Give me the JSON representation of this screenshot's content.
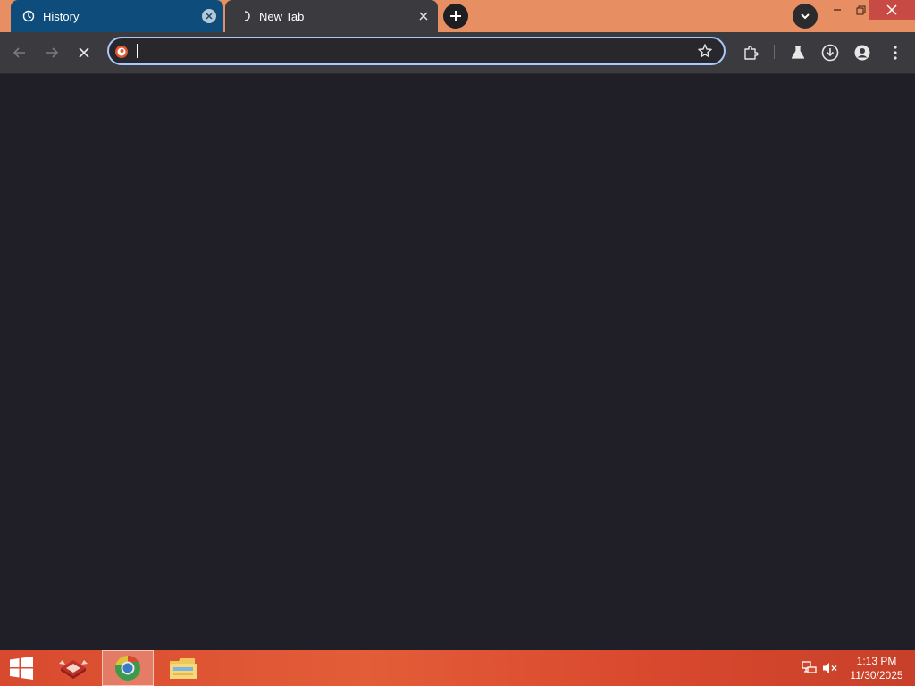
{
  "tabs": [
    {
      "title": "History",
      "icon": "history-icon",
      "active": true
    },
    {
      "title": "New Tab",
      "icon": "loading-spinner-icon",
      "active": false
    }
  ],
  "omnibox": {
    "value": "",
    "placeholder": ""
  },
  "colors": {
    "tabstrip": "#e88e63",
    "active_tab": "#0e4d7b",
    "toolbar": "#3b3b3f",
    "content": "#201f28",
    "omnibox_focus": "#a8c7fa"
  },
  "taskbar": {
    "apps": [
      "windows-start-icon",
      "app-icon",
      "chrome-icon",
      "file-explorer-icon"
    ],
    "clock": {
      "time": "1:13 PM",
      "date": "11/30/2025"
    }
  }
}
